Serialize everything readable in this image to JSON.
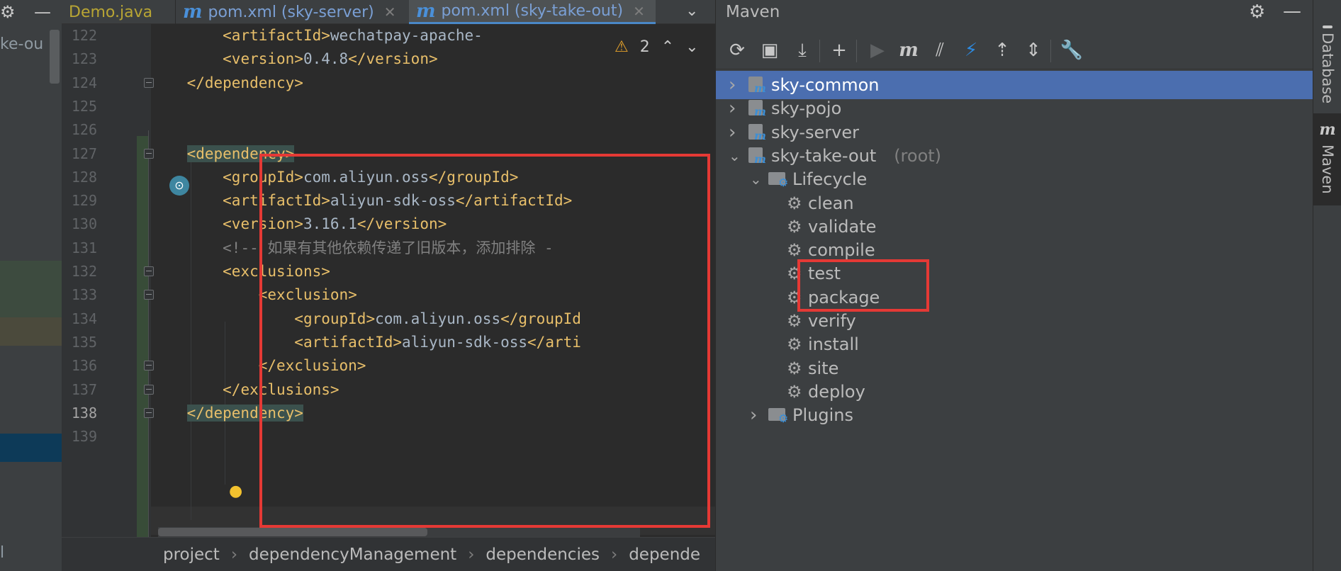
{
  "left_panel": {
    "fragment_text": "ke-ou",
    "fragment_bottom": "l"
  },
  "editor": {
    "tabs": [
      {
        "label": "Demo.java",
        "active": false,
        "icon": ""
      },
      {
        "label": "pom.xml (sky-server)",
        "active": false,
        "icon": "maven-icon"
      },
      {
        "label": "pom.xml (sky-take-out)",
        "active": true,
        "icon": "maven-icon"
      }
    ],
    "close_glyph": "✕",
    "tabs_more": "⌄",
    "warnings": {
      "count": "2"
    },
    "line_numbers": [
      "122",
      "123",
      "124",
      "125",
      "126",
      "127",
      "128",
      "129",
      "130",
      "131",
      "132",
      "133",
      "134",
      "135",
      "136",
      "137",
      "138",
      "139"
    ],
    "current_line": "138",
    "lines": [
      {
        "indent": "        ",
        "tag_open": "<artifactId>",
        "text": "wechatpay-apache-",
        "tag_close": ""
      },
      {
        "indent": "        ",
        "tag_open": "<version>",
        "text": "0.4.8",
        "tag_close": "</version>"
      },
      {
        "indent": "    ",
        "tag_open": "</dependency>",
        "text": "",
        "tag_close": ""
      },
      {
        "indent": "",
        "tag_open": "",
        "text": "",
        "tag_close": ""
      },
      {
        "indent": "",
        "tag_open": "",
        "text": "",
        "tag_close": ""
      },
      {
        "indent": "    ",
        "tag_open": "<dependency>",
        "text": "",
        "tag_close": ""
      },
      {
        "indent": "        ",
        "tag_open": "<groupId>",
        "text": "com.aliyun.oss",
        "tag_close": "</groupId>"
      },
      {
        "indent": "        ",
        "tag_open": "<artifactId>",
        "text": "aliyun-sdk-oss",
        "tag_close": "</artifactId>"
      },
      {
        "indent": "        ",
        "tag_open": "<version>",
        "text": "3.16.1",
        "tag_close": "</version>"
      },
      {
        "indent": "        ",
        "comment": "<!-- 如果有其他依赖传递了旧版本，添加排除 -"
      },
      {
        "indent": "        ",
        "tag_open": "<exclusions>",
        "text": "",
        "tag_close": ""
      },
      {
        "indent": "            ",
        "tag_open": "<exclusion>",
        "text": "",
        "tag_close": ""
      },
      {
        "indent": "                ",
        "tag_open": "<groupId>",
        "text": "com.aliyun.oss",
        "tag_close": "</groupId"
      },
      {
        "indent": "                ",
        "tag_open": "<artifactId>",
        "text": "aliyun-sdk-oss",
        "tag_close": "</arti"
      },
      {
        "indent": "            ",
        "tag_open": "</exclusion>",
        "text": "",
        "tag_close": ""
      },
      {
        "indent": "        ",
        "tag_open": "</exclusions>",
        "text": "",
        "tag_close": ""
      },
      {
        "indent": "    ",
        "tag_open": "</dependency>",
        "text": "",
        "tag_close": ""
      },
      {
        "indent": "",
        "tag_open": "",
        "text": "",
        "tag_close": ""
      }
    ],
    "breadcrumb": [
      "project",
      "dependencyManagement",
      "dependencies",
      "depende"
    ]
  },
  "maven": {
    "title": "Maven",
    "tree": [
      {
        "label": "sky-common",
        "level": 0,
        "expanded": false,
        "selected": true,
        "type": "module"
      },
      {
        "label": "sky-pojo",
        "level": 0,
        "expanded": false,
        "selected": false,
        "type": "module"
      },
      {
        "label": "sky-server",
        "level": 0,
        "expanded": false,
        "selected": false,
        "type": "module"
      },
      {
        "label": "sky-take-out",
        "suffix": "(root)",
        "level": 0,
        "expanded": true,
        "selected": false,
        "type": "module"
      },
      {
        "label": "Lifecycle",
        "level": 1,
        "expanded": true,
        "selected": false,
        "type": "folder"
      },
      {
        "label": "clean",
        "level": 2,
        "type": "goal"
      },
      {
        "label": "validate",
        "level": 2,
        "type": "goal"
      },
      {
        "label": "compile",
        "level": 2,
        "type": "goal"
      },
      {
        "label": "test",
        "level": 2,
        "type": "goal"
      },
      {
        "label": "package",
        "level": 2,
        "type": "goal"
      },
      {
        "label": "verify",
        "level": 2,
        "type": "goal"
      },
      {
        "label": "install",
        "level": 2,
        "type": "goal"
      },
      {
        "label": "site",
        "level": 2,
        "type": "goal"
      },
      {
        "label": "deploy",
        "level": 2,
        "type": "goal"
      },
      {
        "label": "Plugins",
        "level": 1,
        "expanded": false,
        "selected": false,
        "type": "folder"
      }
    ]
  },
  "side_tabs": {
    "database": "Database",
    "maven": "Maven"
  },
  "colors": {
    "accent": "#4b6eaf",
    "highlight_box": "#e53935",
    "xml_tag": "#e8bf6a"
  }
}
